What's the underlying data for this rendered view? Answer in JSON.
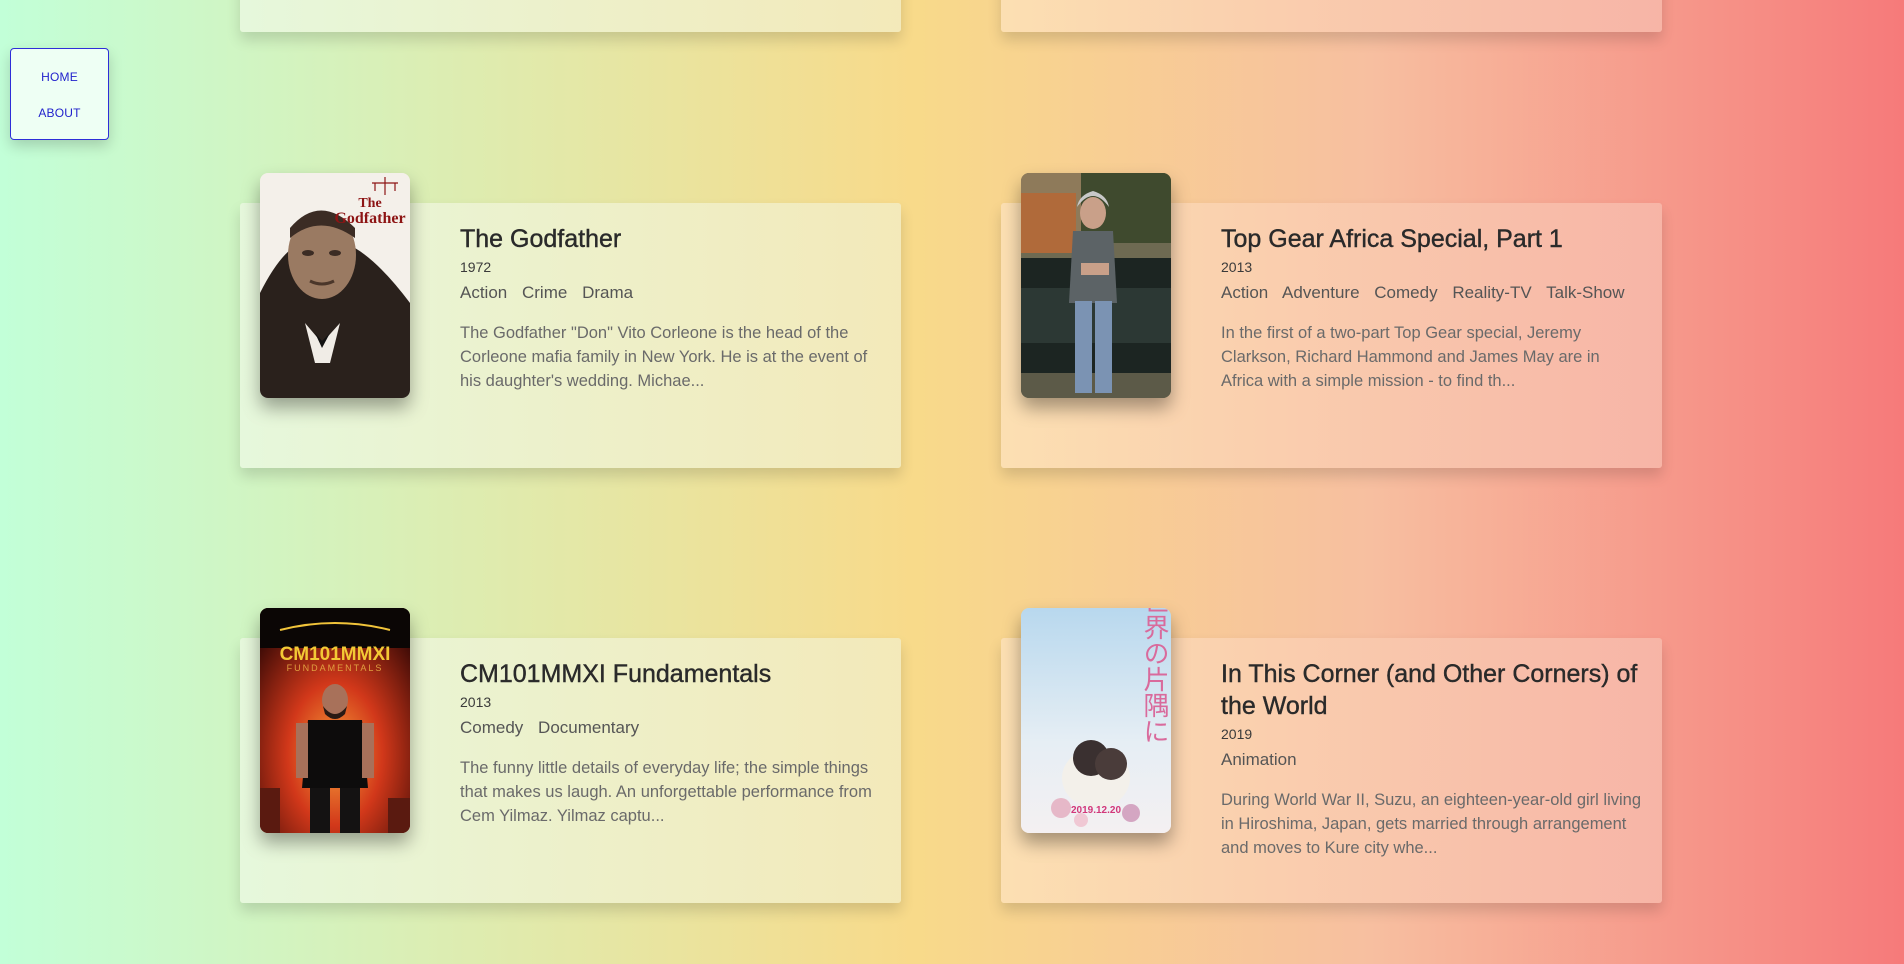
{
  "nav": {
    "items": [
      {
        "label": "HOME"
      },
      {
        "label": "ABOUT"
      }
    ]
  },
  "colors": {
    "nav_link": "#2222cc",
    "nav_border": "#2e2ed8",
    "title_text": "#2a2a2a",
    "description_text": "#6a6a6a"
  },
  "movies": [
    {
      "title": "The Godfather",
      "year": "1972",
      "genres": [
        "Action",
        "Crime",
        "Drama"
      ],
      "description": "The Godfather \"Don\" Vito Corleone is the head of the Corleone mafia family in New York. He is at the event of his daughter's wedding. Michae...",
      "poster_text": "The Godfather"
    },
    {
      "title": "Top Gear Africa Special, Part 1",
      "year": "2013",
      "genres": [
        "Action",
        "Adventure",
        "Comedy",
        "Reality-TV",
        "Talk-Show"
      ],
      "description": "In the first of a two-part Top Gear special, Jeremy Clarkson, Richard Hammond and James May are in Africa with a simple mission - to find th..."
    },
    {
      "title": "CM101MMXI Fundamentals",
      "year": "2013",
      "genres": [
        "Comedy",
        "Documentary"
      ],
      "description": "The funny little details of everyday life; the simple things that makes us laugh. An unforgettable performance from Cem Yilmaz. Yilmaz captu...",
      "poster_text": "CM101MMXI",
      "poster_subtext": "FUNDAMENTALS"
    },
    {
      "title": "In This Corner (and Other Corners) of the World",
      "year": "2019",
      "genres": [
        "Animation"
      ],
      "description": "During World War II, Suzu, an eighteen-year-old girl living in Hiroshima, Japan, gets married through arrangement and moves to Kure city whe...",
      "poster_text": "この世界の片隅に",
      "poster_date": "2019.12.20"
    }
  ]
}
